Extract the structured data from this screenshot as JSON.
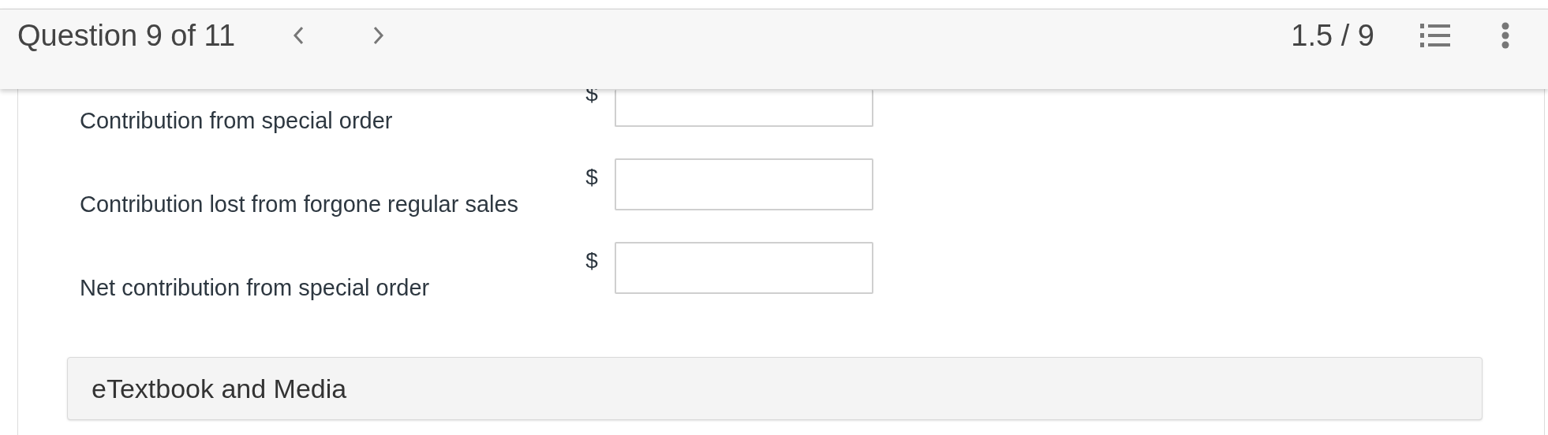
{
  "header": {
    "title": "Question 9 of 11",
    "score": "1.5 / 9"
  },
  "rows": [
    {
      "label": "Contribution from special order",
      "currency": "$"
    },
    {
      "label": "Contribution lost from forgone regular sales",
      "currency": "$"
    },
    {
      "label": "Net contribution from special order",
      "currency": "$"
    }
  ],
  "resources": {
    "label": "eTextbook and Media"
  }
}
